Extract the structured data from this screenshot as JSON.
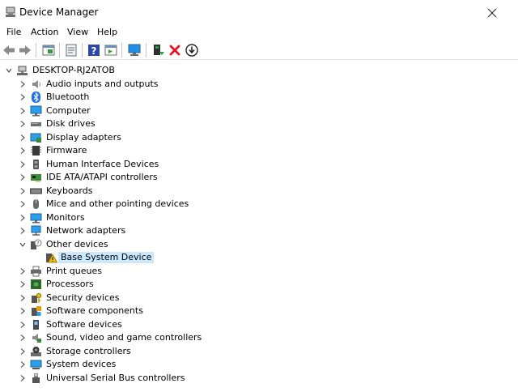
{
  "window": {
    "title": "Device Manager",
    "close_glyph": "✕"
  },
  "menu": {
    "items": [
      "File",
      "Action",
      "View",
      "Help"
    ]
  },
  "toolbar": {
    "buttons": [
      "back-icon",
      "forward-icon",
      "view-tree-icon",
      "properties-icon",
      "help-icon",
      "action-pane-icon",
      "monitor-icon",
      "update-driver-icon",
      "uninstall-icon",
      "download-icon"
    ]
  },
  "tree": {
    "root": "DESKTOP-RJ2ATOB",
    "selected": "Base System Device",
    "categories": [
      {
        "label": "Audio inputs and outputs",
        "icon": "speaker-icon"
      },
      {
        "label": "Bluetooth",
        "icon": "bluetooth-icon"
      },
      {
        "label": "Computer",
        "icon": "computer-icon"
      },
      {
        "label": "Disk drives",
        "icon": "disk-drive-icon"
      },
      {
        "label": "Display adapters",
        "icon": "display-adapter-icon"
      },
      {
        "label": "Firmware",
        "icon": "firmware-icon"
      },
      {
        "label": "Human Interface Devices",
        "icon": "hid-icon"
      },
      {
        "label": "IDE ATA/ATAPI controllers",
        "icon": "ide-controller-icon"
      },
      {
        "label": "Keyboards",
        "icon": "keyboard-icon"
      },
      {
        "label": "Mice and other pointing devices",
        "icon": "mouse-icon"
      },
      {
        "label": "Monitors",
        "icon": "monitor-icon"
      },
      {
        "label": "Network adapters",
        "icon": "network-adapter-icon"
      },
      {
        "label": "Other devices",
        "icon": "other-devices-icon",
        "expanded": true,
        "children": [
          {
            "label": "Base System Device",
            "icon": "warning-device-icon"
          }
        ]
      },
      {
        "label": "Print queues",
        "icon": "printer-icon"
      },
      {
        "label": "Processors",
        "icon": "processor-icon"
      },
      {
        "label": "Security devices",
        "icon": "security-key-icon"
      },
      {
        "label": "Software components",
        "icon": "software-component-icon"
      },
      {
        "label": "Software devices",
        "icon": "software-device-icon"
      },
      {
        "label": "Sound, video and game controllers",
        "icon": "sound-controller-icon"
      },
      {
        "label": "Storage controllers",
        "icon": "storage-controller-icon"
      },
      {
        "label": "System devices",
        "icon": "system-device-icon"
      },
      {
        "label": "Universal Serial Bus controllers",
        "icon": "usb-icon"
      }
    ]
  },
  "colors": {
    "selection": "#cce8ff",
    "accent_blue": "#1e90e8",
    "error_red": "#e81123",
    "green": "#22a34a"
  }
}
